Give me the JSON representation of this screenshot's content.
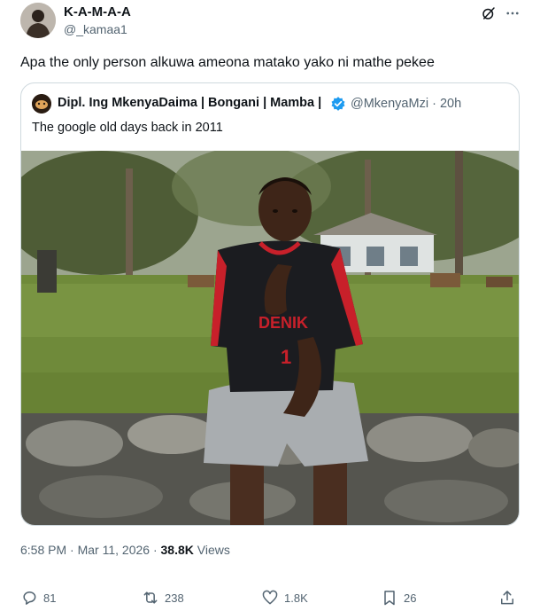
{
  "author": {
    "display_name": "K-A-M-A-A",
    "handle": "@_kamaa1"
  },
  "tweet": {
    "text": "Apa the only person alkuwa ameona matako yako ni mathe pekee",
    "time": "6:58 PM",
    "separator": " · ",
    "date": "Mar 11, 2026",
    "views_count": "38.8K",
    "views_label": " Views"
  },
  "quote": {
    "display_name": "Dipl. Ing MkenyaDaima | Bongani | Mamba |",
    "handle": "@MkenyaMzi",
    "age": "20h",
    "text": "The google old days back in 2011",
    "shirt_text": "DENIK",
    "shirt_number": "1"
  },
  "actions": {
    "replies": "81",
    "reposts": "238",
    "likes": "1.8K",
    "bookmarks": "26"
  },
  "icons": [
    "grok-icon",
    "more-icon",
    "verified-icon",
    "reply-icon",
    "repost-icon",
    "like-icon",
    "bookmark-icon",
    "share-icon"
  ],
  "colors": {
    "verified": "#1d9bf0",
    "secondary_text": "#536471",
    "border": "#cfd9de"
  }
}
